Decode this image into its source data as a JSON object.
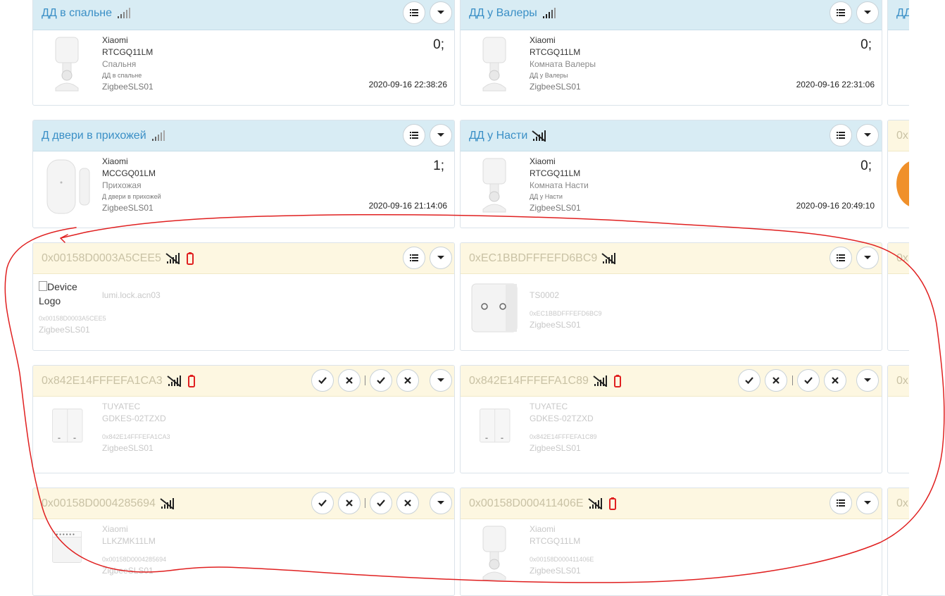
{
  "cards": {
    "c1": {
      "title": "ДД в спальне",
      "vendor": "Xiaomi",
      "model": "RTCGQ11LM",
      "location": "Спальня",
      "name_small": "ДД в спальне",
      "gateway": "ZigbeeSLS01",
      "value": "0;",
      "timestamp": "2020-09-16 22:38:26"
    },
    "c2": {
      "title": "ДД у Валеры",
      "vendor": "Xiaomi",
      "model": "RTCGQ11LM",
      "location": "Комната Валеры",
      "name_small": "ДД у Валеры",
      "gateway": "ZigbeeSLS01",
      "value": "0;",
      "timestamp": "2020-09-16 22:31:06"
    },
    "c3": {
      "title": "ДД"
    },
    "c4": {
      "title": "Д двери в прихожей",
      "vendor": "Xiaomi",
      "model": "MCCGQ01LM",
      "location": "Прихожая",
      "name_small": "Д двери в прихожей",
      "gateway": "ZigbeeSLS01",
      "value": "1;",
      "timestamp": "2020-09-16 21:14:06"
    },
    "c5": {
      "title": "ДД у Насти",
      "vendor": "Xiaomi",
      "model": "RTCGQ11LM",
      "location": "Комната Насти",
      "name_small": "ДД у Насти",
      "gateway": "ZigbeeSLS01",
      "value": "0;",
      "timestamp": "2020-09-16 20:49:10"
    },
    "c6": {
      "title": "0x"
    },
    "c7": {
      "title": "0x00158D0003A5CEE5",
      "alt": "Device Logo",
      "model": "lumi.lock.acn03",
      "addr": "0x00158D0003A5CEE5",
      "gateway": "ZigbeeSLS01"
    },
    "c8": {
      "title": "0xEC1BBDFFFEFD6BC9",
      "model": "TS0002",
      "addr": "0xEC1BBDFFFEFD6BC9",
      "gateway": "ZigbeeSLS01"
    },
    "c9": {
      "title": "0x"
    },
    "c10": {
      "title": "0x842E14FFFEFA1CA3",
      "vendor": "TUYATEC",
      "model": "GDKES-02TZXD",
      "addr": "0x842E14FFFEFA1CA3",
      "gateway": "ZigbeeSLS01"
    },
    "c11": {
      "title": "0x842E14FFFEFA1C89",
      "vendor": "TUYATEC",
      "model": "GDKES-02TZXD",
      "addr": "0x842E14FFFEFA1C89",
      "gateway": "ZigbeeSLS01"
    },
    "c12": {
      "title": "0x"
    },
    "c13": {
      "title": "0x00158D0004285694",
      "vendor": "Xiaomi",
      "model": "LLKZMK11LM",
      "addr": "0x00158D0004285694",
      "gateway": "ZigbeeSLS01"
    },
    "c14": {
      "title": "0x00158D000411406E",
      "vendor": "Xiaomi",
      "model": "RTCGQ11LM",
      "addr": "0x00158D000411406E",
      "gateway": "ZigbeeSLS01"
    },
    "c15": {
      "title": "0x"
    }
  },
  "colors": {
    "accent": "#3a8fc6",
    "online_header": "#d8ecf4",
    "offline_header": "#fdf7e1",
    "annotation": "#e02020",
    "battery": "#e02020"
  },
  "icons": {
    "menu": "list-icon",
    "dropdown": "caret-down-icon",
    "on": "check-icon",
    "off": "x-icon",
    "signal": "signal-bars-icon",
    "no_signal": "no-signal-icon",
    "battery": "battery-icon"
  }
}
